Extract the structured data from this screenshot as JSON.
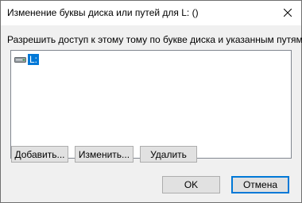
{
  "window": {
    "title": "Изменение буквы диска или путей для L: ()"
  },
  "description": "Разрешить доступ к этому тому по букве диска и указанным путям.",
  "list": {
    "items": [
      {
        "label": "L:",
        "selected": true,
        "icon": "drive-icon"
      }
    ]
  },
  "buttons": {
    "add": "Добавить...",
    "edit": "Изменить...",
    "remove": "Удалить",
    "ok": "OK",
    "cancel": "Отмена"
  },
  "colors": {
    "selection": "#0078d7",
    "default_button_border": "#0078d7",
    "dialog_background": "#f0f0f0"
  }
}
